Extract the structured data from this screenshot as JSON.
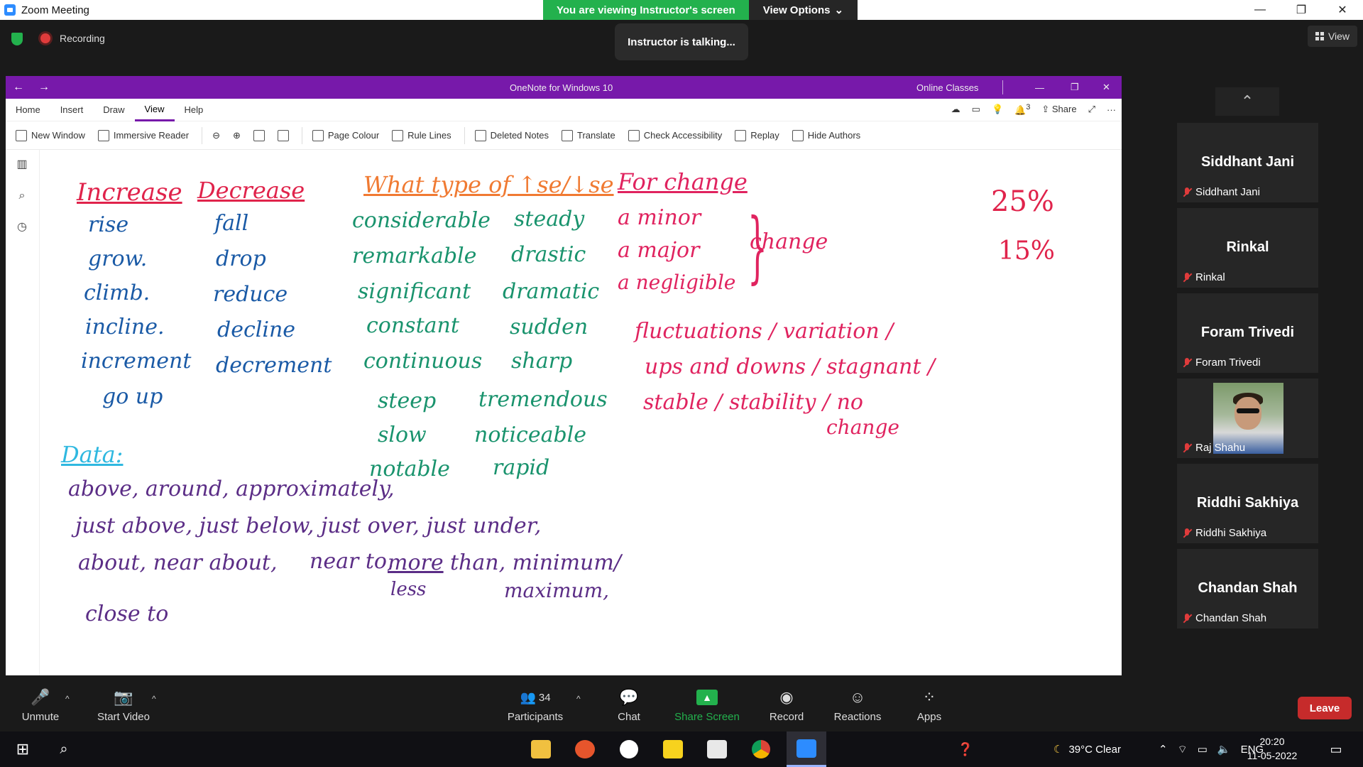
{
  "zoom": {
    "window_title": "Zoom Meeting",
    "banner_text": "You are viewing Instructor's screen",
    "view_options_label": "View Options",
    "recording_label": "Recording",
    "talking_text": "Instructor is talking...",
    "view_label": "View"
  },
  "onenote": {
    "title": "OneNote for Windows 10",
    "notebook": "Online Classes",
    "tabs": [
      "Home",
      "Insert",
      "Draw",
      "View",
      "Help"
    ],
    "active_tab": "View",
    "share_label": "Share",
    "notification_count": "3",
    "toolbar": {
      "new_window": "New Window",
      "immersive_reader": "Immersive Reader",
      "page_colour": "Page Colour",
      "rule_lines": "Rule Lines",
      "deleted_notes": "Deleted Notes",
      "translate": "Translate",
      "check_accessibility": "Check Accessibility",
      "replay": "Replay",
      "hide_authors": "Hide Authors"
    }
  },
  "notes": {
    "increase_heading": "Increase",
    "increase_words": [
      "rise",
      "grow.",
      "climb.",
      "incline.",
      "increment",
      "go up"
    ],
    "decrease_heading": "Decrease",
    "decrease_words": [
      "fall",
      "drop",
      "reduce",
      "decline",
      "decrement"
    ],
    "type_heading": "What type of ↑se/↓se",
    "adjectives_left": [
      "considerable",
      "remarkable",
      "significant",
      "constant",
      "continuous",
      "steep",
      "slow",
      "notable"
    ],
    "adjectives_right": [
      "steady",
      "drastic",
      "dramatic",
      "sudden",
      "sharp",
      "tremendous",
      "noticeable",
      "rapid"
    ],
    "change_heading": "For change",
    "change_items": [
      "a minor",
      "a major",
      "a negligible"
    ],
    "change_word": "change",
    "fluct_line1": "fluctuations / variation /",
    "fluct_line2": "ups and downs / stagnant /",
    "fluct_line3": "stable / stability / no",
    "fluct_line4": "change",
    "pct1": "25%",
    "pct2": "15%",
    "data_heading": "Data:",
    "data_line1": "above, around, approximately,",
    "data_line2": "just above, just below, just over, just under,",
    "data_line3a": "about, near about,",
    "data_line3b": "near to,",
    "data_line3c": "more",
    "data_line3d": "than, minimum/",
    "data_line4a": "less",
    "data_line4b": "maximum,",
    "data_line5": "close to"
  },
  "participants": [
    {
      "tile_name": "Siddhant Jani",
      "label": "Siddhant Jani",
      "has_photo": false
    },
    {
      "tile_name": "Rinkal",
      "label": "Rinkal",
      "has_photo": false
    },
    {
      "tile_name": "Foram Trivedi",
      "label": "Foram Trivedi",
      "has_photo": false
    },
    {
      "tile_name": "",
      "label": "Raj Shahu",
      "has_photo": true
    },
    {
      "tile_name": "Riddhi Sakhiya",
      "label": "Riddhi Sakhiya",
      "has_photo": false
    },
    {
      "tile_name": "Chandan Shah",
      "label": "Chandan Shah",
      "has_photo": false
    }
  ],
  "controls": {
    "unmute": "Unmute",
    "start_video": "Start Video",
    "participants_label": "Participants",
    "participants_count": "34",
    "chat": "Chat",
    "share_screen": "Share Screen",
    "record": "Record",
    "reactions": "Reactions",
    "apps": "Apps",
    "leave": "Leave"
  },
  "taskbar": {
    "weather": "39°C  Clear",
    "lang": "ENG",
    "time": "20:20",
    "date": "11-05-2022"
  },
  "colors": {
    "onenote_purple": "#7719aa",
    "zoom_green": "#23b14d",
    "leave_red": "#c62b2b"
  }
}
